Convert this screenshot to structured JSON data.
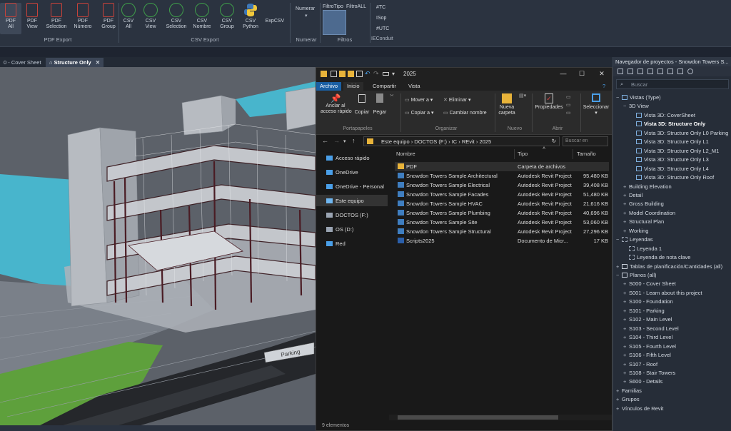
{
  "ribbon": {
    "buttons": [
      {
        "label": "PDF\nAll",
        "kind": "pdf",
        "active": true
      },
      {
        "label": "PDF\nView",
        "kind": "pdf"
      },
      {
        "label": "PDF\nSelection",
        "kind": "pdf"
      },
      {
        "label": "PDF\nNúmero",
        "kind": "pdf"
      },
      {
        "label": "PDF\nGroup",
        "kind": "pdf"
      },
      {
        "label": "CSV\nAll",
        "kind": "csv"
      },
      {
        "label": "CSV\nView",
        "kind": "csv"
      },
      {
        "label": "CSV\nSelection",
        "kind": "csv"
      },
      {
        "label": "CSV\nNombre",
        "kind": "csv"
      },
      {
        "label": "CSV\nGroup",
        "kind": "csv"
      },
      {
        "label": "CSV\nPython",
        "kind": "py"
      },
      {
        "label": "ExpCSV",
        "kind": "none"
      }
    ],
    "group_pdf": "PDF Export",
    "group_csv": "CSV Export",
    "numerar_top": "Numerar",
    "numerar_group": "Numerar",
    "filtro_tipo": "FiltroTipo",
    "filtro_all": "FiltroALL",
    "filtros_group": "Filtros",
    "tags": [
      "#TC",
      "ISop",
      "#UTC",
      "IEConduit"
    ]
  },
  "view_tabs": {
    "cover": "0 - Cover Sheet",
    "structure": "Structure Only"
  },
  "viewport": {
    "parking_label": "Parking"
  },
  "explorer": {
    "title_path": "2025",
    "tabs": [
      "Archivo",
      "Inicio",
      "Compartir",
      "Vista"
    ],
    "ribbon": {
      "anclar": "Anclar al\nacceso rápido",
      "copiar": "Copiar",
      "pegar": "Pegar",
      "portapapeles": "Portapapeles",
      "mover": "Mover a",
      "copiar_a": "Copiar a",
      "eliminar": "Eliminar",
      "cambiar": "Cambiar nombre",
      "organizar": "Organizar",
      "nueva": "Nueva\ncarpeta",
      "nuevo": "Nuevo",
      "propiedades": "Propiedades",
      "abrir": "Abrir",
      "seleccionar": "Seleccionar"
    },
    "address": [
      "Este equipo",
      "DOCTOS (F:)",
      "IC",
      "REvit",
      "2025"
    ],
    "search_placeholder": "Buscar en",
    "nav": [
      {
        "label": "Acceso rápido",
        "color": "#4a9fe8"
      },
      {
        "label": "OneDrive",
        "color": "#4a9fe8"
      },
      {
        "label": "OneDrive - Personal",
        "color": "#4a9fe8"
      },
      {
        "label": "Este equipo",
        "color": "#6fb6f0",
        "selected": true
      },
      {
        "label": "DOCTOS (F:)",
        "color": "#9aa4b2"
      },
      {
        "label": "OS (D:)",
        "color": "#9aa4b2"
      },
      {
        "label": "Red",
        "color": "#4a9fe8"
      }
    ],
    "columns": {
      "name": "Nombre",
      "type": "Tipo",
      "size": "Tamaño"
    },
    "files": [
      {
        "name": "PDF",
        "type": "Carpeta de archivos",
        "size": "",
        "icon": "folder"
      },
      {
        "name": "Snowdon Towers Sample Architectural",
        "type": "Autodesk Revit Project",
        "size": "95,480 KB",
        "icon": "rvt"
      },
      {
        "name": "Snowdon Towers Sample Electrical",
        "type": "Autodesk Revit Project",
        "size": "39,408 KB",
        "icon": "rvt"
      },
      {
        "name": "Snowdon Towers Sample Facades",
        "type": "Autodesk Revit Project",
        "size": "51,480 KB",
        "icon": "rvt"
      },
      {
        "name": "Snowdon Towers Sample HVAC",
        "type": "Autodesk Revit Project",
        "size": "21,616 KB",
        "icon": "rvt"
      },
      {
        "name": "Snowdon Towers Sample Plumbing",
        "type": "Autodesk Revit Project",
        "size": "40,696 KB",
        "icon": "rvt"
      },
      {
        "name": "Snowdon Towers Sample Site",
        "type": "Autodesk Revit Project",
        "size": "53,060 KB",
        "icon": "rvt"
      },
      {
        "name": "Snowdon Towers Sample Structural",
        "type": "Autodesk Revit Project",
        "size": "27,296 KB",
        "icon": "rvt"
      },
      {
        "name": "Scripts2025",
        "type": "Documento de Micr...",
        "size": "17 KB",
        "icon": "doc"
      }
    ],
    "status": "9 elementos"
  },
  "project_browser": {
    "title": "Navegador de proyectos - Snowdon Towers S...",
    "search_placeholder": "Buscar",
    "tree": [
      {
        "label": "Vistas (Type)",
        "level": 0,
        "tog": "⊟",
        "icon": "view"
      },
      {
        "label": "3D View",
        "level": 1,
        "tog": "⊟",
        "icon": ""
      },
      {
        "label": "Vista 3D: CoverSheet",
        "level": 2,
        "tog": "",
        "icon": "view"
      },
      {
        "label": "Vista 3D: Structure Only",
        "level": 2,
        "tog": "",
        "icon": "view",
        "bold": true
      },
      {
        "label": "Vista 3D: Structure Only L0 Parking",
        "level": 2,
        "tog": "",
        "icon": "view"
      },
      {
        "label": "Vista 3D: Structure Only L1",
        "level": 2,
        "tog": "",
        "icon": "view"
      },
      {
        "label": "Vista 3D: Structure Only L2_M1",
        "level": 2,
        "tog": "",
        "icon": "view"
      },
      {
        "label": "Vista 3D: Structure Only L3",
        "level": 2,
        "tog": "",
        "icon": "view"
      },
      {
        "label": "Vista 3D: Structure Only L4",
        "level": 2,
        "tog": "",
        "icon": "view"
      },
      {
        "label": "Vista 3D: Structure Only Roof",
        "level": 2,
        "tog": "",
        "icon": "view"
      },
      {
        "label": "Building Elevation",
        "level": 1,
        "tog": "⊞",
        "icon": ""
      },
      {
        "label": "Detail",
        "level": 1,
        "tog": "⊞",
        "icon": ""
      },
      {
        "label": "Gross Building",
        "level": 1,
        "tog": "⊞",
        "icon": ""
      },
      {
        "label": "Model Coordination",
        "level": 1,
        "tog": "⊞",
        "icon": ""
      },
      {
        "label": "Structural Plan",
        "level": 1,
        "tog": "⊞",
        "icon": ""
      },
      {
        "label": "Working",
        "level": 1,
        "tog": "⊞",
        "icon": ""
      },
      {
        "label": "Leyendas",
        "level": 0,
        "tog": "⊟",
        "icon": "leg"
      },
      {
        "label": "Leyenda 1",
        "level": 1,
        "tog": "",
        "icon": "leg"
      },
      {
        "label": "Leyenda de nota clave",
        "level": 1,
        "tog": "",
        "icon": "leg"
      },
      {
        "label": "Tablas de planificación/Cantidades (all)",
        "level": 0,
        "tog": "⊞",
        "icon": "sheet"
      },
      {
        "label": "Planos (all)",
        "level": 0,
        "tog": "⊟",
        "icon": "sheet"
      },
      {
        "label": "S000 - Cover Sheet",
        "level": 1,
        "tog": "⊞",
        "icon": ""
      },
      {
        "label": "S001 - Learn about this project",
        "level": 1,
        "tog": "⊞",
        "icon": ""
      },
      {
        "label": "S100 - Foundation",
        "level": 1,
        "tog": "⊞",
        "icon": ""
      },
      {
        "label": "S101 - Parking",
        "level": 1,
        "tog": "⊞",
        "icon": ""
      },
      {
        "label": "S102 - Main Level",
        "level": 1,
        "tog": "⊞",
        "icon": ""
      },
      {
        "label": "S103 - Second Level",
        "level": 1,
        "tog": "⊞",
        "icon": ""
      },
      {
        "label": "S104 - Third Level",
        "level": 1,
        "tog": "⊞",
        "icon": ""
      },
      {
        "label": "S105 - Fourth Level",
        "level": 1,
        "tog": "⊞",
        "icon": ""
      },
      {
        "label": "S106 - Fifth Level",
        "level": 1,
        "tog": "⊞",
        "icon": ""
      },
      {
        "label": "S107 - Roof",
        "level": 1,
        "tog": "⊞",
        "icon": ""
      },
      {
        "label": "S108 - Stair Towers",
        "level": 1,
        "tog": "⊞",
        "icon": ""
      },
      {
        "label": "S600 - Details",
        "level": 1,
        "tog": "⊞",
        "icon": ""
      },
      {
        "label": "Familias",
        "level": 0,
        "tog": "⊞",
        "icon": ""
      },
      {
        "label": "Grupos",
        "level": 0,
        "tog": "⊞",
        "icon": ""
      },
      {
        "label": "Vínculos de Revit",
        "level": 0,
        "tog": "⊞",
        "icon": ""
      }
    ]
  }
}
